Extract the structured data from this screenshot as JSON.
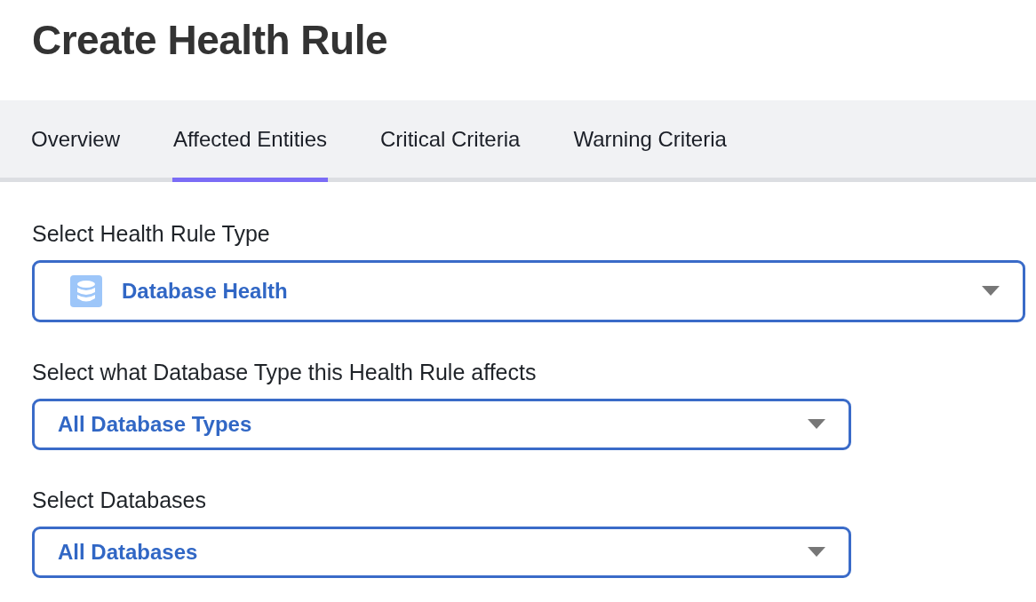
{
  "title": "Create Health Rule",
  "tabs": [
    {
      "label": "Overview",
      "selected": false
    },
    {
      "label": "Affected Entities",
      "selected": true
    },
    {
      "label": "Critical Criteria",
      "selected": false
    },
    {
      "label": "Warning Criteria",
      "selected": false
    }
  ],
  "fields": [
    {
      "kind": "with-icon",
      "label": "Select Health Rule Type",
      "value": "Database Health"
    },
    {
      "kind": "plain",
      "label": "Select what Database Type this Health Rule affects",
      "value": "All Database Types"
    },
    {
      "kind": "plain",
      "label": "Select Databases",
      "value": "All Databases"
    }
  ]
}
